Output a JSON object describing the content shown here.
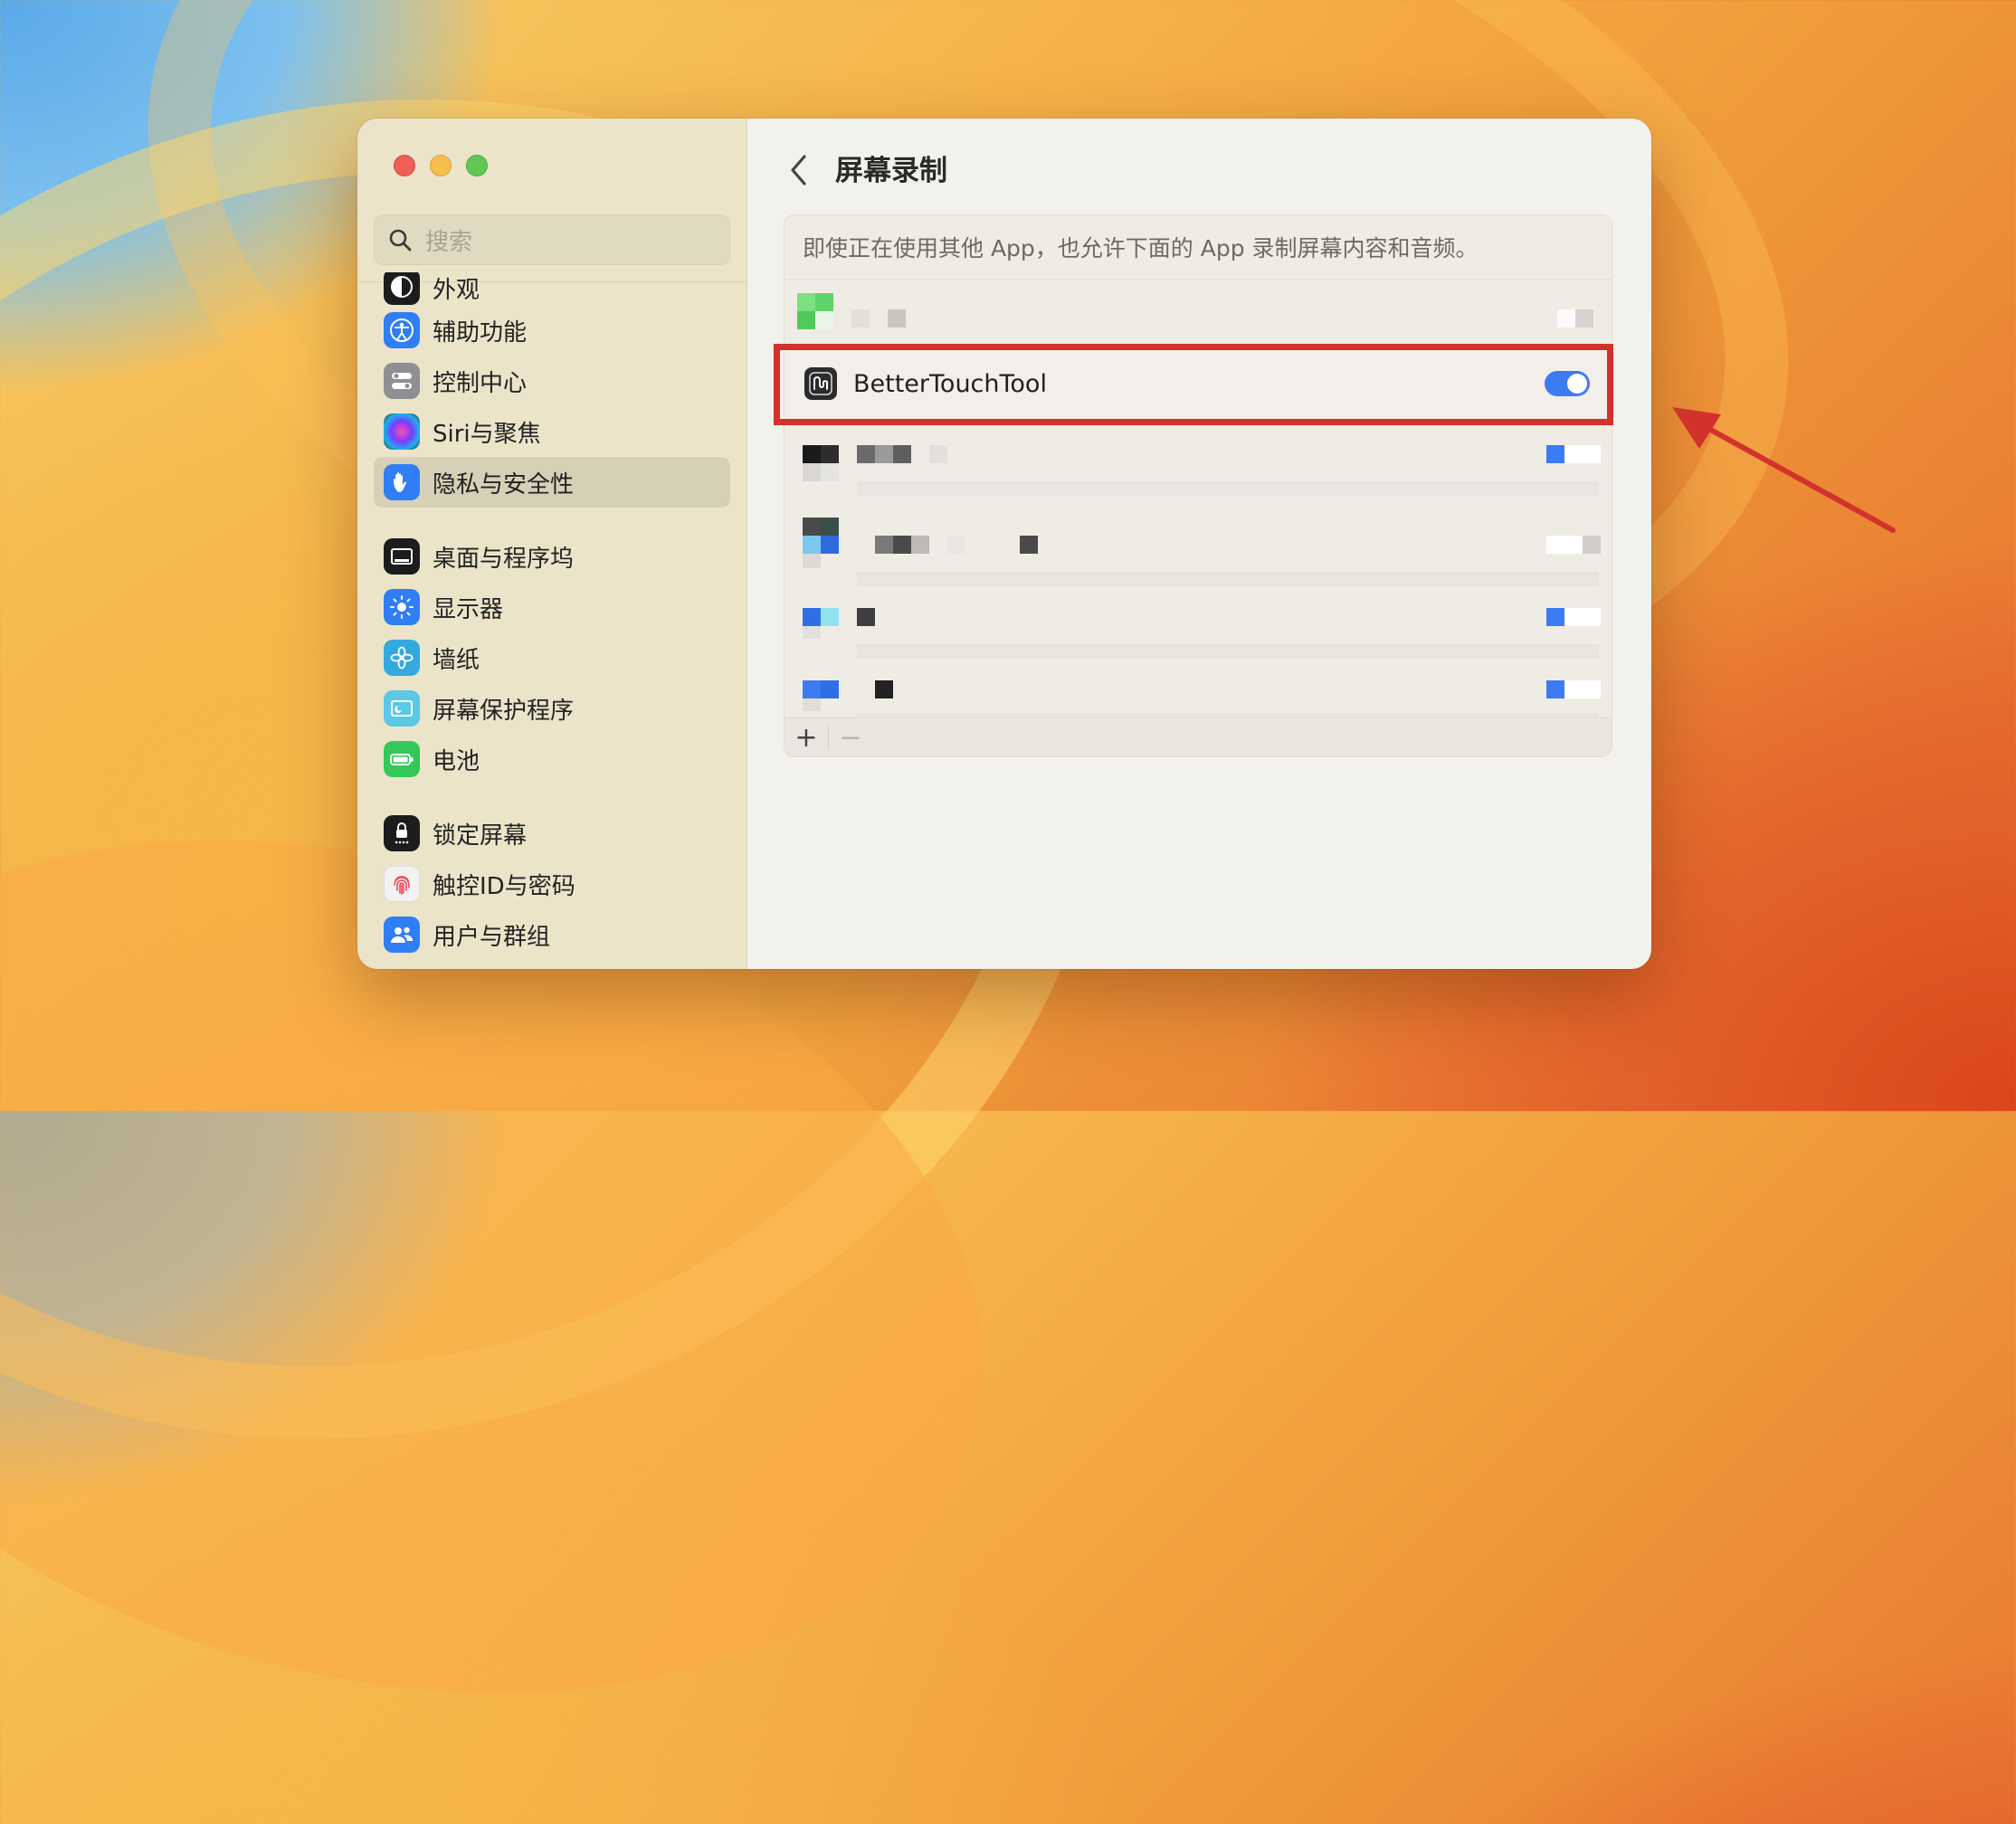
{
  "window": {
    "title": "屏幕录制",
    "search": {
      "placeholder": "搜索"
    }
  },
  "sidebar": {
    "items": [
      {
        "label": "外观",
        "icon": "appearance-icon"
      },
      {
        "label": "辅助功能",
        "icon": "accessibility-icon"
      },
      {
        "label": "控制中心",
        "icon": "control-center-icon"
      },
      {
        "label": "Siri与聚焦",
        "icon": "siri-icon"
      },
      {
        "label": "隐私与安全性",
        "icon": "privacy-hand-icon",
        "selected": true
      },
      {
        "label": "桌面与程序坞",
        "icon": "desktop-dock-icon"
      },
      {
        "label": "显示器",
        "icon": "display-icon"
      },
      {
        "label": "墙纸",
        "icon": "wallpaper-icon"
      },
      {
        "label": "屏幕保护程序",
        "icon": "screensaver-icon"
      },
      {
        "label": "电池",
        "icon": "battery-icon"
      },
      {
        "label": "锁定屏幕",
        "icon": "lock-screen-icon"
      },
      {
        "label": "触控ID与密码",
        "icon": "touch-id-icon"
      },
      {
        "label": "用户与群组",
        "icon": "users-groups-icon"
      }
    ]
  },
  "main": {
    "description": "即使正在使用其他 App，也允许下面的 App 录制屏幕内容和音频。",
    "highlighted_app": {
      "name": "BetterTouchTool",
      "enabled": true
    },
    "footer": {
      "add": "+",
      "remove": "−"
    }
  },
  "colors": {
    "accent": "#3d7bf2",
    "highlight": "#d2322c"
  }
}
